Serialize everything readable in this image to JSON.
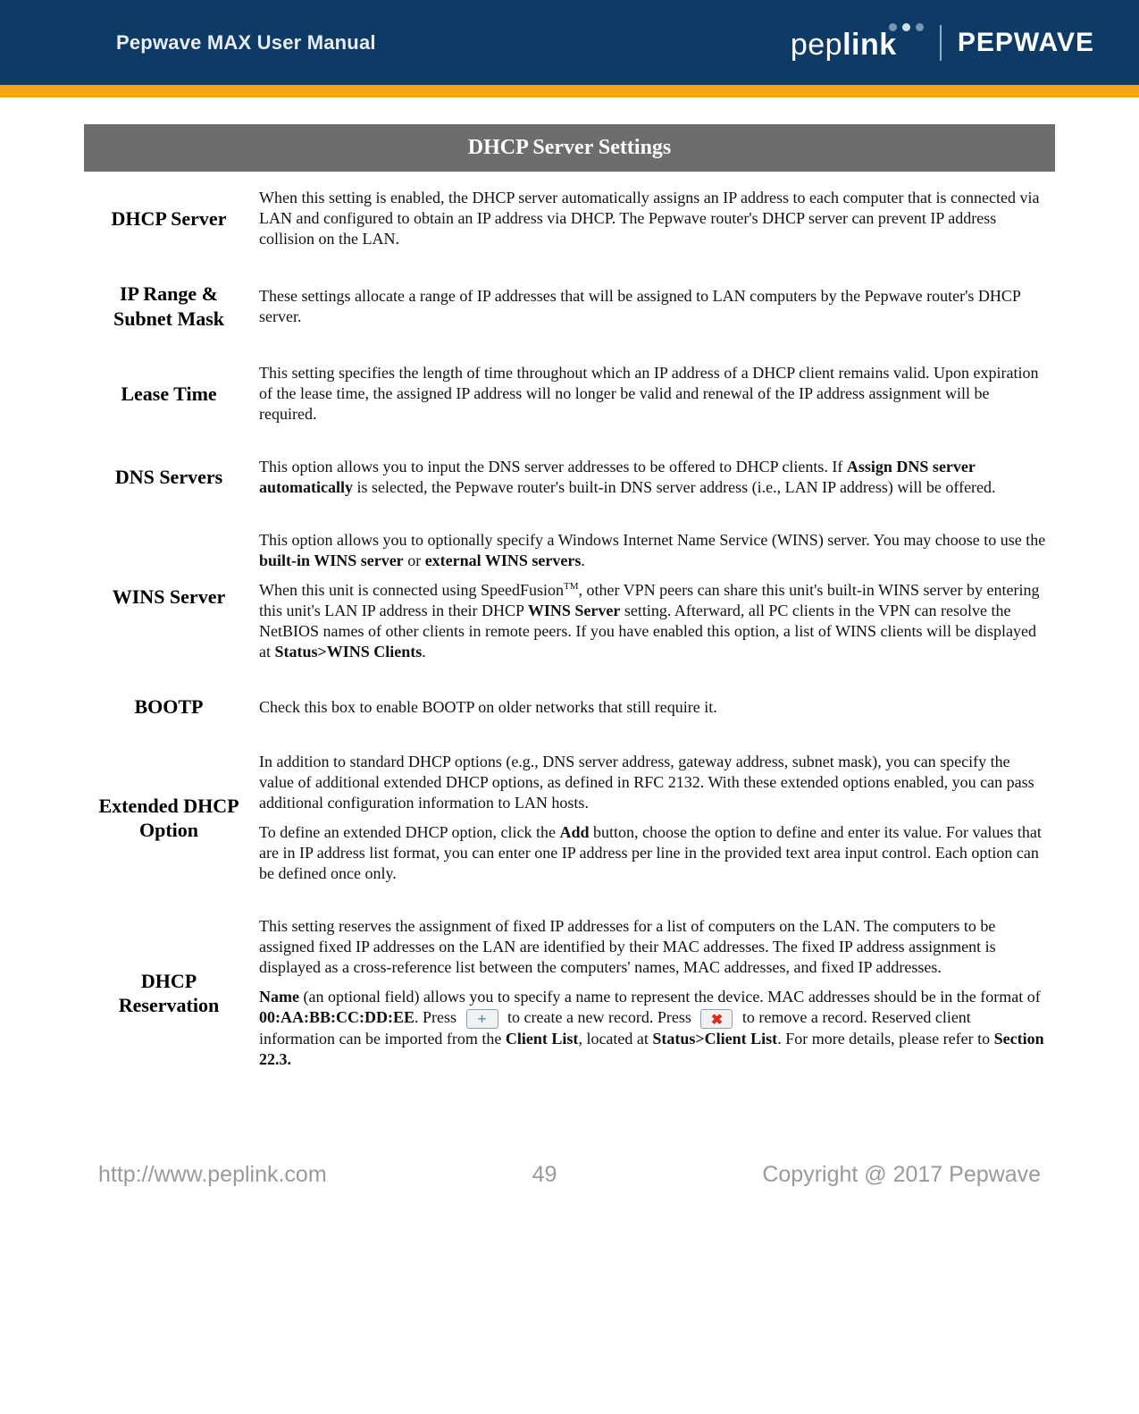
{
  "header": {
    "doc_title": "Pepwave MAX User Manual",
    "brand_left_thin": "pep",
    "brand_left_bold": "link",
    "brand_right": "PEPWAVE"
  },
  "table": {
    "title": "DHCP Server Settings",
    "rows": {
      "dhcp_server": {
        "label": "DHCP Server",
        "desc": "When this setting is enabled, the DHCP server automatically assigns an IP address to each computer that is connected via LAN and configured to obtain an IP address via DHCP. The Pepwave router's DHCP server can prevent IP address collision on the LAN."
      },
      "ip_range": {
        "label": "IP Range & Subnet Mask",
        "desc": "These settings allocate a range of IP addresses that will be assigned to LAN computers by the Pepwave router's DHCP server."
      },
      "lease_time": {
        "label": "Lease Time",
        "desc": "This setting specifies the length of time throughout which an IP address of a DHCP client remains valid. Upon expiration of the lease time, the assigned IP address will no longer be valid and renewal of the IP address assignment will be required."
      },
      "dns_servers": {
        "label": "DNS Servers",
        "desc_pre": "This option allows you to input the DNS server addresses to be offered to DHCP clients. If ",
        "desc_bold": "Assign DNS server automatically",
        "desc_post": " is selected, the Pepwave router's built-in DNS server address (i.e., LAN IP address) will be offered."
      },
      "wins_server": {
        "label": "WINS Server",
        "p1_pre": "This option allows you to optionally specify a Windows Internet Name Service (WINS) server. You may choose to use the ",
        "p1_b1": "built-in WINS server",
        "p1_mid": " or ",
        "p1_b2": "external WINS servers",
        "p1_post": ".",
        "p2_pre": "When this unit is connected using SpeedFusion",
        "p2_tm": "TM",
        "p2_mid": ", other VPN peers can share this unit's built-in WINS server by entering this unit's LAN IP address in their DHCP ",
        "p2_b1": "WINS Server",
        "p2_mid2": " setting. Afterward, all PC clients in the VPN can resolve the NetBIOS names of other clients in remote peers. If you have enabled this option, a list of WINS clients will be displayed at ",
        "p2_b2": "Status>WINS Clients",
        "p2_post": "."
      },
      "bootp": {
        "label": "BOOTP",
        "desc": "Check this box to enable BOOTP on older networks that still require it."
      },
      "extended": {
        "label": "Extended DHCP Option",
        "p1": "In addition to standard DHCP options (e.g., DNS server address, gateway address, subnet mask), you can specify the value of additional extended DHCP options, as defined in RFC 2132. With these extended options enabled, you can pass additional configuration information to LAN hosts.",
        "p2_pre": "To define an extended DHCP option, click the ",
        "p2_b1": "Add",
        "p2_post": " button, choose the option to define and enter its value. For values that are in IP address list format, you can enter one IP address per line in the provided text area input control. Each option can be defined once only."
      },
      "reservation": {
        "label": "DHCP Reservation",
        "p1": "This setting reserves the assignment of fixed IP addresses for a list of computers on the LAN. The computers to be assigned fixed IP addresses on the LAN are identified by their MAC addresses. The fixed IP address assignment is displayed as a cross-reference list between the computers' names, MAC addresses, and fixed IP addresses.",
        "p2_b1": "Name",
        "p2_seg1": " (an optional field) allows you to specify a name to represent the device. MAC addresses should be in the format of ",
        "p2_b2": "00:AA:BB:CC:DD:EE",
        "p2_seg2": ". Press ",
        "p2_seg3": " to create a new record. Press ",
        "p2_seg4": " to remove a record. Reserved client information can be imported from the ",
        "p2_b3": "Client List",
        "p2_seg5": ", located at ",
        "p2_b4": "Status>Client List",
        "p2_seg6": ". For more details, please refer to ",
        "p2_b5": "Section 22.3."
      }
    }
  },
  "footer": {
    "url": "http://www.peplink.com",
    "page": "49",
    "copyright": "Copyright @ 2017 Pepwave"
  }
}
